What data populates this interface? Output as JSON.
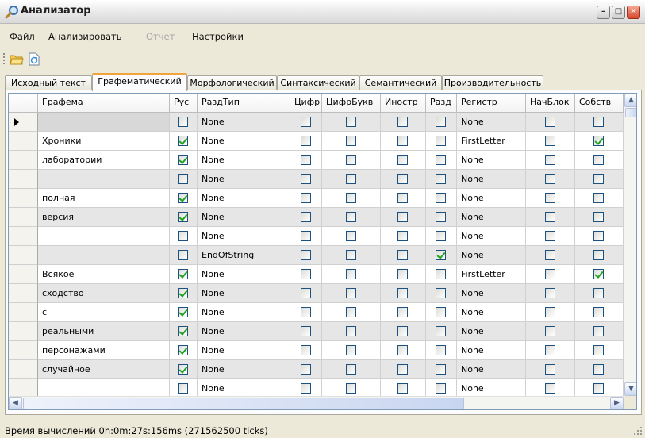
{
  "window": {
    "title": "Анализатор"
  },
  "menu": {
    "file": "Файл",
    "analyze": "Анализировать",
    "report": "Отчет",
    "settings": "Настройки"
  },
  "toolbar": {
    "open_icon": "folder-open-icon",
    "refresh_icon": "document-refresh-icon"
  },
  "tabs": [
    {
      "label": "Исходный текст",
      "active": false
    },
    {
      "label": "Графематический",
      "active": true
    },
    {
      "label": "Морфологический",
      "active": false
    },
    {
      "label": "Синтаксический",
      "active": false
    },
    {
      "label": "Семантический",
      "active": false
    },
    {
      "label": "Производительность",
      "active": false
    }
  ],
  "grid": {
    "columns": [
      "Графема",
      "Рус",
      "РаздТип",
      "Цифр",
      "ЦифрБукв",
      "Инostр",
      "Разд",
      "Регистр",
      "НачБлок",
      "Собств"
    ],
    "rows": [
      {
        "grafema": "",
        "rus": false,
        "razdtip": "None",
        "tsifr": false,
        "tsifrbukv": false,
        "inostr": false,
        "razd": false,
        "registr": "None",
        "nachblok": false,
        "sobstv": false,
        "current": true
      },
      {
        "grafema": "Хроники",
        "rus": true,
        "razdtip": "None",
        "tsifr": false,
        "tsifrbukv": false,
        "inostr": false,
        "razd": false,
        "registr": "FirstLetter",
        "nachblok": false,
        "sobstv": true
      },
      {
        "grafema": "лаборатории",
        "rus": true,
        "razdtip": "None",
        "tsifr": false,
        "tsifrbukv": false,
        "inostr": false,
        "razd": false,
        "registr": "None",
        "nachblok": false,
        "sobstv": false
      },
      {
        "grafema": "",
        "rus": false,
        "razdtip": "None",
        "tsifr": false,
        "tsifrbukv": false,
        "inostr": false,
        "razd": false,
        "registr": "None",
        "nachblok": false,
        "sobstv": false
      },
      {
        "grafema": "полная",
        "rus": true,
        "razdtip": "None",
        "tsifr": false,
        "tsifrbukv": false,
        "inostr": false,
        "razd": false,
        "registr": "None",
        "nachblok": false,
        "sobstv": false
      },
      {
        "grafema": "версия",
        "rus": true,
        "razdtip": "None",
        "tsifr": false,
        "tsifrbukv": false,
        "inostr": false,
        "razd": false,
        "registr": "None",
        "nachblok": false,
        "sobstv": false
      },
      {
        "grafema": "",
        "rus": false,
        "razdtip": "None",
        "tsifr": false,
        "tsifrbukv": false,
        "inostr": false,
        "razd": false,
        "registr": "None",
        "nachblok": false,
        "sobstv": false
      },
      {
        "grafema": "",
        "rus": false,
        "razdtip": "EndOfString",
        "tsifr": false,
        "tsifrbukv": false,
        "inostr": false,
        "razd": true,
        "registr": "None",
        "nachblok": false,
        "sobstv": false
      },
      {
        "grafema": "Всякое",
        "rus": true,
        "razdtip": "None",
        "tsifr": false,
        "tsifrbukv": false,
        "inostr": false,
        "razd": false,
        "registr": "FirstLetter",
        "nachblok": false,
        "sobstv": true
      },
      {
        "grafema": "сходство",
        "rus": true,
        "razdtip": "None",
        "tsifr": false,
        "tsifrbukv": false,
        "inostr": false,
        "razd": false,
        "registr": "None",
        "nachblok": false,
        "sobstv": false
      },
      {
        "grafema": "с",
        "rus": true,
        "razdtip": "None",
        "tsifr": false,
        "tsifrbukv": false,
        "inostr": false,
        "razd": false,
        "registr": "None",
        "nachblok": false,
        "sobstv": false
      },
      {
        "grafema": "реальными",
        "rus": true,
        "razdtip": "None",
        "tsifr": false,
        "tsifrbukv": false,
        "inostr": false,
        "razd": false,
        "registr": "None",
        "nachblok": false,
        "sobstv": false
      },
      {
        "grafema": "персонажами",
        "rus": true,
        "razdtip": "None",
        "tsifr": false,
        "tsifrbukv": false,
        "inostr": false,
        "razd": false,
        "registr": "None",
        "nachblok": false,
        "sobstv": false
      },
      {
        "grafema": "случайное",
        "rus": true,
        "razdtip": "None",
        "tsifr": false,
        "tsifrbukv": false,
        "inostr": false,
        "razd": false,
        "registr": "None",
        "nachblok": false,
        "sobstv": false
      },
      {
        "grafema": "",
        "rus": false,
        "razdtip": "None",
        "tsifr": false,
        "tsifrbukv": false,
        "inostr": false,
        "razd": false,
        "registr": "None",
        "nachblok": false,
        "sobstv": false
      }
    ]
  },
  "status": {
    "text": "Время вычислений 0h:0m:27s:156ms (271562500 ticks)"
  }
}
